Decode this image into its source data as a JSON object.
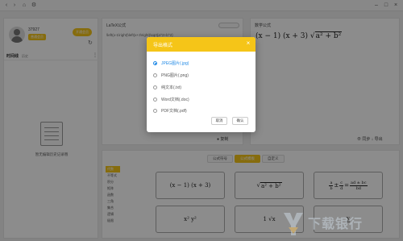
{
  "titlebar": {
    "icons": [
      "back-icon",
      "forward-icon",
      "home-icon",
      "settings-icon"
    ],
    "window_controls": [
      "minimize",
      "maximize",
      "close"
    ]
  },
  "user": {
    "name": "37927",
    "badge": "普通会员",
    "vip_button": "开通会员"
  },
  "history": {
    "title": "时间线",
    "subtitle": "历史",
    "empty_text": "暂无编辑历史记录哦"
  },
  "latex_panel": {
    "title": "LaTeX公式",
    "code": "\\left(x-1\\right)\\left(x+3\\right)\\sqrt{a^2+b^2}",
    "footer": "● 复制"
  },
  "preview_panel": {
    "title": "数学公式",
    "formula_main": "(x − 1) (x + 3)",
    "formula_sqrt": "a² + b²",
    "footer": "⊕ 同步   ↓ 导出"
  },
  "bottom": {
    "tabs": [
      "公式符号",
      "公式模板",
      "自定义"
    ],
    "active_tab": 1,
    "categories": [
      "代数",
      "不等式",
      "积分",
      "矩阵",
      "函数",
      "三角",
      "集合",
      "逻辑",
      "极限"
    ],
    "active_category": 0,
    "cards": {
      "c1": "(x − 1) (x + 3)",
      "c2_sqrt": "a² + b²",
      "c3_frac1_num": "a",
      "c3_frac1_den": "b",
      "c3_frac2_num": "c",
      "c3_frac2_den": "d",
      "c3_frac3_num": "ad ± bc",
      "c3_frac3_den": "bd",
      "c4": "x²   y²",
      "c5": "1   √x",
      "c6": "∑"
    }
  },
  "dialog": {
    "title": "导出格式",
    "close": "×",
    "options": [
      "JPEG图片(.jpg)",
      "PNG图片(.png)",
      "纯文本(.txt)",
      "Word文档(.doc)",
      "PDF文档(.pdf)"
    ],
    "selected_index": 0,
    "cancel_label": "取消",
    "confirm_label": "确认"
  },
  "watermark": {
    "text": "下载银行"
  },
  "colors": {
    "accent": "#f5c518",
    "selected": "#1e88e5",
    "overlay": "rgba(0,0,0,0.45)"
  }
}
